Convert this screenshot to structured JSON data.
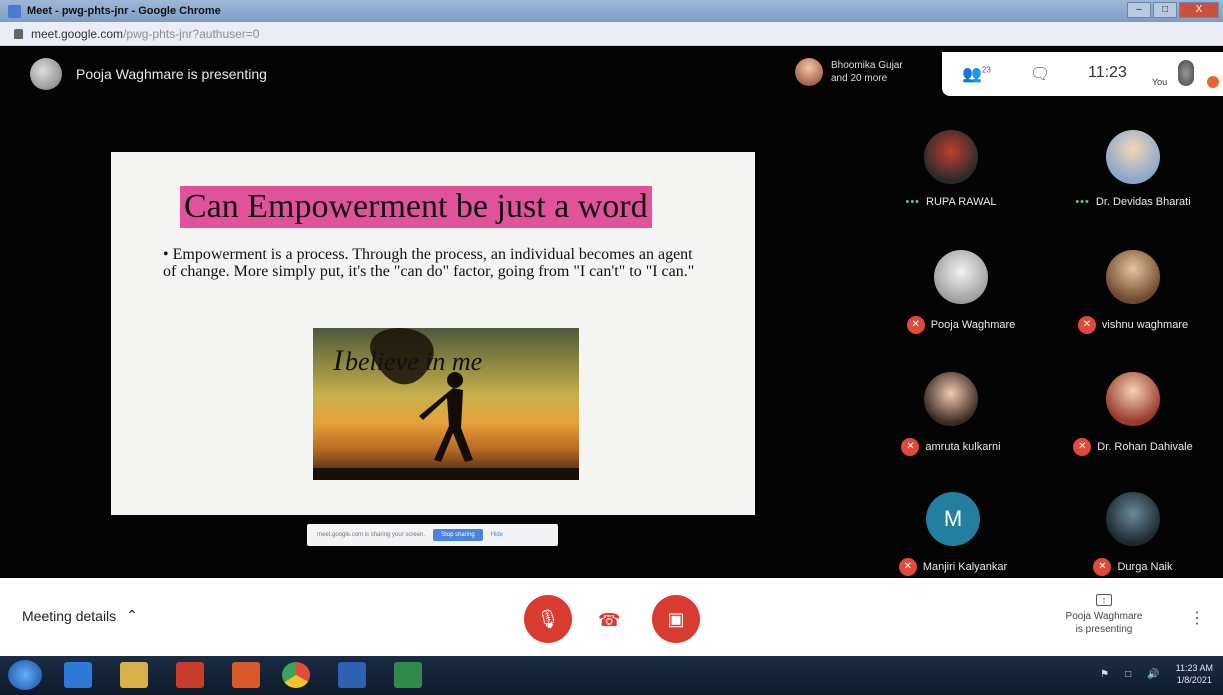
{
  "window": {
    "title": "Meet - pwg-phts-jnr - Google Chrome",
    "url_host": "meet.google.com",
    "url_path": "/pwg-phts-jnr?authuser=0",
    "controls": [
      "–",
      "□",
      "X"
    ]
  },
  "presenter": {
    "banner": "Pooja Waghmare is presenting"
  },
  "others": {
    "line1": "Bhoomika Gujar",
    "line2": "and 20 more"
  },
  "topbar": {
    "participants_count": "23",
    "time": "11:23",
    "you_label": "You"
  },
  "slide": {
    "title": "Can Empowerment  be just a word",
    "bullet": "Empowerment is a process. Through the process, an individual becomes an agent of change. More simply put, it's the \"can do\" factor, going from \"I can't\" to \"I can.\"",
    "image_caption_pre": "I",
    "image_caption": "believe in me"
  },
  "share_bar": {
    "message": "meet.google.com is sharing your screen.",
    "stop_label": "Stop sharing",
    "hide_label": "Hide"
  },
  "participants": [
    {
      "name": "RUPA RAWAL",
      "status": "speaking"
    },
    {
      "name": "Dr. Devidas Bharati",
      "status": "speaking"
    },
    {
      "name": "Pooja Waghmare",
      "status": "muted"
    },
    {
      "name": "vishnu waghmare",
      "status": "muted"
    },
    {
      "name": "amruta kulkarni",
      "status": "muted"
    },
    {
      "name": "Dr. Rohan Dahivale",
      "status": "muted"
    },
    {
      "name": "Manjiri Kalyankar",
      "status": "muted",
      "initial": "M"
    },
    {
      "name": "Durga Naik",
      "status": "muted"
    }
  ],
  "controls": {
    "meeting_details": "Meeting details",
    "presenting_line1": "Pooja Waghmare",
    "presenting_line2": "is presenting"
  },
  "taskbar": {
    "clock_time": "11:23 AM",
    "clock_date": "1/8/2021"
  },
  "colors": {
    "slide_title_highlight": "#e0529a",
    "control_red": "#d93b30",
    "meet_stage": "#040404"
  }
}
